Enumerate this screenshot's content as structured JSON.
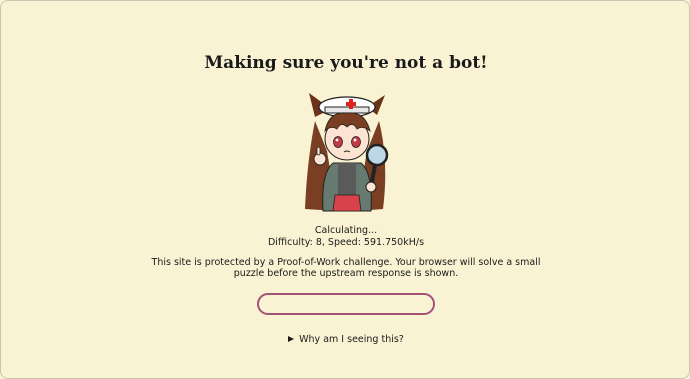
{
  "heading": "Making sure you're not a bot!",
  "status": {
    "state": "Calculating...",
    "metrics": "Difficulty: 8, Speed: 591.750kH/s"
  },
  "notice": "This site is protected by a Proof-of-Work challenge. Your browser will solve a small puzzle before the upstream response is shown.",
  "progress": {
    "fraction": 0
  },
  "details": {
    "summary": "Why am I seeing this?"
  },
  "colors": {
    "background": "#f9f3d4",
    "progress_border": "#a65278",
    "text": "#1a1a1a"
  },
  "icons": {
    "mascot": "mascot-girl-magnifying-glass-icon",
    "disclosure": "disclosure-triangle-icon"
  }
}
